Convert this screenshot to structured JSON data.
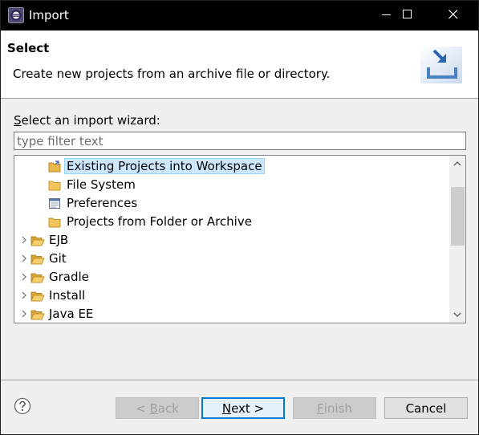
{
  "window": {
    "title": "Import",
    "icon": "eclipse-icon",
    "controls": {
      "minimize": "minimize-icon",
      "maximize": "maximize-icon",
      "close": "close-icon"
    }
  },
  "header": {
    "heading": "Select",
    "description": "Create new projects from an archive file or directory.",
    "banner_icon": "import-wizard-icon"
  },
  "wizard": {
    "label_mnemonic": "S",
    "label_rest": "elect an import wizard:",
    "filter_value": "",
    "filter_placeholder": "type filter text"
  },
  "tree": {
    "items": [
      {
        "label": "Existing Projects into Workspace",
        "icon": "existing-project-icon",
        "level": 1,
        "selected": true,
        "expandable": false
      },
      {
        "label": "File System",
        "icon": "folder-icon",
        "level": 1,
        "selected": false,
        "expandable": false
      },
      {
        "label": "Preferences",
        "icon": "preferences-icon",
        "level": 1,
        "selected": false,
        "expandable": false
      },
      {
        "label": "Projects from Folder or Archive",
        "icon": "folder-icon",
        "level": 1,
        "selected": false,
        "expandable": false
      },
      {
        "label": "EJB",
        "icon": "folder-open-icon",
        "level": 0,
        "selected": false,
        "expandable": true
      },
      {
        "label": "Git",
        "icon": "folder-open-icon",
        "level": 0,
        "selected": false,
        "expandable": true
      },
      {
        "label": "Gradle",
        "icon": "folder-open-icon",
        "level": 0,
        "selected": false,
        "expandable": true
      },
      {
        "label": "Install",
        "icon": "folder-open-icon",
        "level": 0,
        "selected": false,
        "expandable": true
      },
      {
        "label": "Java EE",
        "icon": "folder-open-icon",
        "level": 0,
        "selected": false,
        "expandable": true
      }
    ]
  },
  "footer": {
    "help_icon": "help-icon",
    "back": {
      "prefix": "< ",
      "mnemonic": "B",
      "rest": "ack",
      "enabled": false
    },
    "next": {
      "mnemonic": "N",
      "rest": "ext >",
      "enabled": true
    },
    "finish": {
      "mnemonic": "F",
      "rest": "inish",
      "enabled": false
    },
    "cancel": {
      "label": "Cancel",
      "enabled": true
    }
  },
  "colors": {
    "titlebar": "#000000",
    "selection": "#cce8ff",
    "default_button_border": "#0078d7",
    "folder": "#e8b84a"
  }
}
